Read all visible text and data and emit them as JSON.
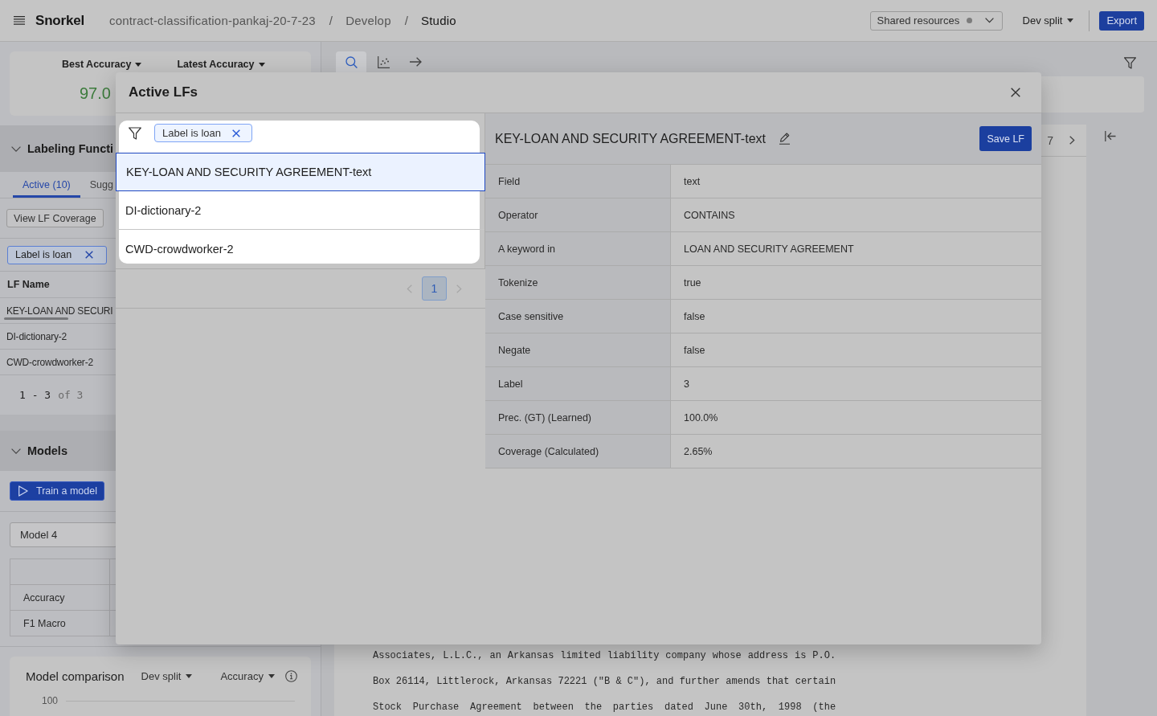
{
  "top_bar": {
    "logo": "Snorkel",
    "breadcrumb": [
      {
        "label": "contract-classification-pankaj-20-7-23",
        "current": false,
        "separator": "/"
      },
      {
        "label": "Develop",
        "current": false,
        "separator": "/"
      },
      {
        "label": "Studio",
        "current": true
      }
    ],
    "resources_select": "Shared resources",
    "split_select": "Dev split",
    "export_button": "Export"
  },
  "left_panel": {
    "metrics": [
      {
        "label": "Best Accuracy",
        "value": "97.0"
      },
      {
        "label": "Latest Accuracy"
      }
    ],
    "labeling_functions": {
      "title": "Labeling Functi",
      "expanded": true,
      "tabs": [
        {
          "label": "Active (10)",
          "selected": true
        },
        {
          "label": "Sugg",
          "selected": false
        }
      ],
      "coverage_button": "View LF Coverage",
      "filter_chip": "Label is loan",
      "table": {
        "columns": [
          "LF Name"
        ],
        "rows": [
          {
            "name": "KEY-LOAN AND SECURI",
            "scrollable": true
          },
          {
            "name": "DI-dictionary-2",
            "scrollable": false
          },
          {
            "name": "CWD-crowdworker-2",
            "scrollable": false
          }
        ]
      },
      "pagination": {
        "range": "1 - 3",
        "total": "of 3"
      }
    },
    "models": {
      "title": "Models",
      "expanded": true,
      "train_button": "Train a model",
      "model_select": "Model 4",
      "metrics_table": {
        "rows": [
          "Accuracy",
          "F1 Macro"
        ]
      }
    },
    "model_comparison": {
      "title": "Model comparison",
      "split_select": "Dev split",
      "metric_select": "Accuracy",
      "y_tick": "100"
    }
  },
  "main": {
    "toolbar": [
      {
        "kind": "search",
        "selected": true
      },
      {
        "kind": "scatter",
        "selected": false
      },
      {
        "kind": "arrow",
        "selected": false
      }
    ],
    "pager": {
      "count": "7"
    },
    "document_lines": [
      "Associates, L.L.C., an Arkansas limited liability company whose address is P.O.",
      "Box 26114, Littlerock, Arkansas 72221 (\"B & C\"), and further amends that certain",
      "Stock Purchase Agreement between the parties dated June 30th, 1998 (the"
    ]
  },
  "modal": {
    "title": "Active LFs",
    "filter_chip": "Label is loan",
    "lfs": [
      {
        "name": "KEY-LOAN AND SECURITY AGREEMENT-text",
        "selected": true
      },
      {
        "name": "DI-dictionary-2",
        "selected": false
      },
      {
        "name": "CWD-crowdworker-2",
        "selected": false
      }
    ],
    "pagination": {
      "prev": {
        "disabled": true
      },
      "pages": [
        {
          "label": "1",
          "selected": true
        }
      ],
      "next": {
        "disabled": true
      }
    },
    "detail": {
      "title": "KEY-LOAN AND SECURITY AGREEMENT-text",
      "save_button": "Save LF",
      "fields": [
        {
          "label": "Field",
          "value": "text"
        },
        {
          "label": "Operator",
          "value": "CONTAINS"
        },
        {
          "label": "A keyword in",
          "value": "LOAN AND SECURITY AGREEMENT"
        },
        {
          "label": "Tokenize",
          "value": "true"
        },
        {
          "label": "Case sensitive",
          "value": "false"
        },
        {
          "label": "Negate",
          "value": "false"
        },
        {
          "label": "Label",
          "value": "3"
        },
        {
          "label": "Prec. (GT) (Learned)",
          "value": "100.0%"
        },
        {
          "label": "Coverage (Calculated)",
          "value": "2.65%"
        }
      ]
    }
  }
}
